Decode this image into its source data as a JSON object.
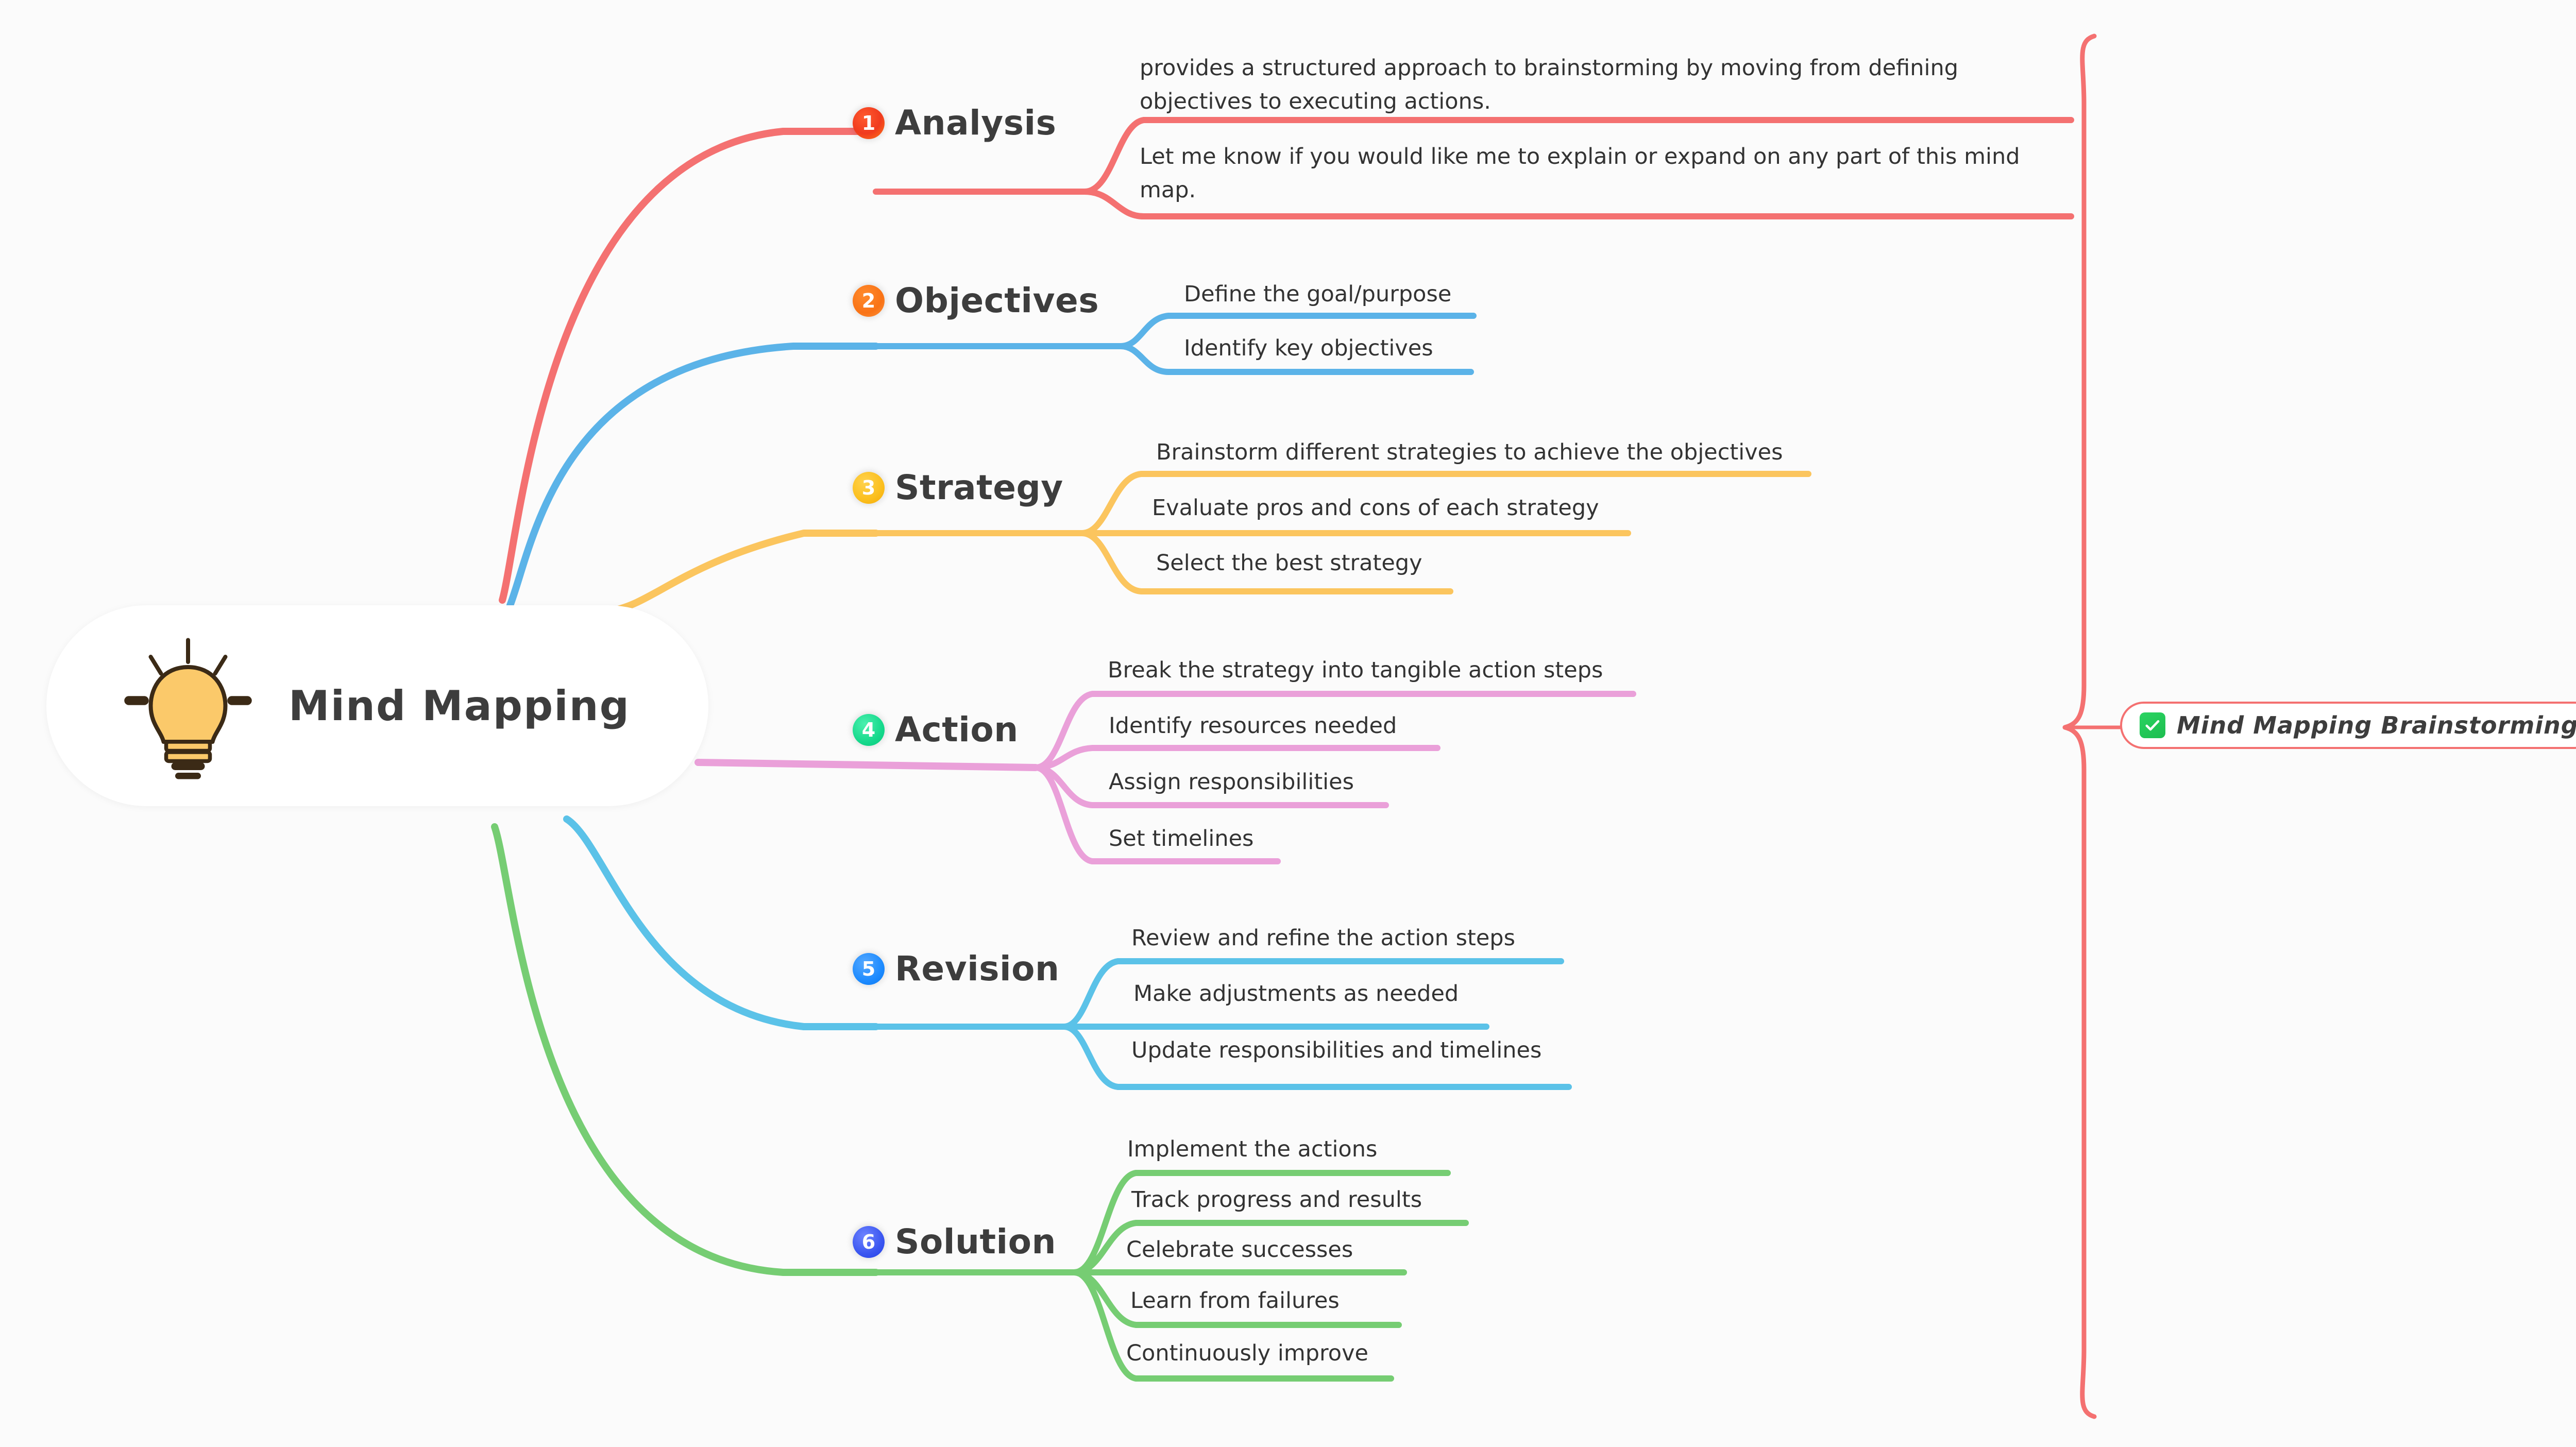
{
  "center": {
    "title": "Mind Mapping",
    "icon": "lightbulb-icon",
    "bulb_color": "#fbc96a",
    "bulb_outline": "#3b2a16"
  },
  "summary": {
    "icon": "check-mark-icon",
    "label": "Mind Mapping Brainstorming",
    "border_color": "#f47171",
    "check_color": "#22c55e"
  },
  "branches": [
    {
      "number": "1",
      "title": "Analysis",
      "color": "#f47171",
      "badge_color": "#f03b1e",
      "leaves": [
        "provides a structured approach to brainstorming by moving from defining objectives to executing actions.",
        "Let me know if you would like me to explain or expand on any part of this mind map."
      ]
    },
    {
      "number": "2",
      "title": "Objectives",
      "color": "#5bb3e8",
      "badge_color": "#f97316",
      "leaves": [
        "Define the goal/purpose",
        "Identify key objectives"
      ]
    },
    {
      "number": "3",
      "title": "Strategy",
      "color": "#fbc55e",
      "badge_color": "#fbbf1e",
      "leaves": [
        "Brainstorm different strategies to achieve the objectives",
        "Evaluate pros and cons of each strategy",
        "Select the best strategy"
      ]
    },
    {
      "number": "4",
      "title": "Action",
      "color": "#eaa0d9",
      "badge_color": "#16d98c",
      "leaves": [
        "Break the strategy into tangible action steps",
        "Identify resources needed",
        "Assign responsibilities",
        "Set timelines"
      ]
    },
    {
      "number": "5",
      "title": "Revision",
      "color": "#5bc2e8",
      "badge_color": "#1d8bff",
      "leaves": [
        "Review and refine the action steps",
        "Make adjustments as needed",
        "Update responsibilities and timelines"
      ]
    },
    {
      "number": "6",
      "title": "Solution",
      "color": "#76cd73",
      "badge_color": "#3a56f0",
      "leaves": [
        "Implement the actions",
        "Track progress and results",
        "Celebrate successes",
        "Learn from failures",
        "Continuously improve"
      ]
    }
  ]
}
